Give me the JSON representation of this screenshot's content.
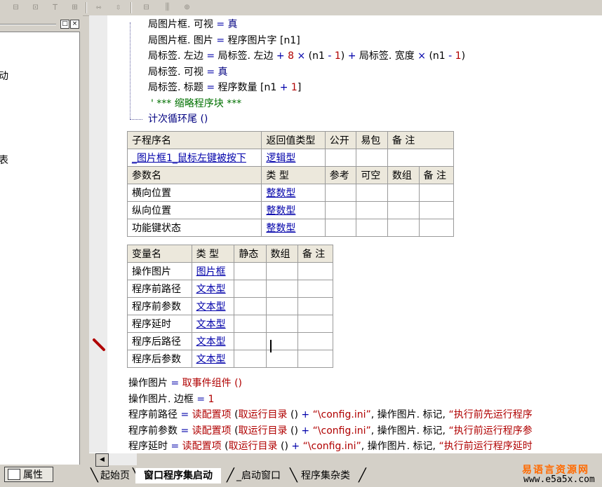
{
  "toolbar": {
    "icons": [
      "align-left-icon",
      "align-center-icon",
      "align-top-icon",
      "align-middle-icon",
      "same-width-icon",
      "same-height-icon",
      "space-horizontal-icon",
      "space-vertical-icon",
      "center-icon"
    ]
  },
  "left_panel": {
    "partial_text_1": "动",
    "partial_text_2": "表",
    "min_btn": "□",
    "close_btn": "×",
    "prop_label": "属性"
  },
  "code_top": [
    {
      "parts": [
        {
          "t": "局图片框. 可视 "
        },
        {
          "t": "= ",
          "c": "kw-blue"
        },
        {
          "t": "真",
          "c": "kw-navy"
        }
      ]
    },
    {
      "parts": [
        {
          "t": "局图片框. 图片 "
        },
        {
          "t": "= ",
          "c": "kw-blue"
        },
        {
          "t": "程序图片字 [n1]"
        }
      ]
    },
    {
      "parts": [
        {
          "t": "局标签. 左边 "
        },
        {
          "t": "= ",
          "c": "kw-blue"
        },
        {
          "t": "局标签. 左边 "
        },
        {
          "t": "+ ",
          "c": "kw-blue"
        },
        {
          "t": "8 ",
          "c": "kw-red"
        },
        {
          "t": "× ",
          "c": "kw-blue"
        },
        {
          "t": "(n1 "
        },
        {
          "t": "- ",
          "c": "kw-blue"
        },
        {
          "t": "1",
          "c": "kw-red"
        },
        {
          "t": ") "
        },
        {
          "t": "+ ",
          "c": "kw-blue"
        },
        {
          "t": "局标签. 宽度 "
        },
        {
          "t": "× ",
          "c": "kw-blue"
        },
        {
          "t": "(n1 "
        },
        {
          "t": "- ",
          "c": "kw-blue"
        },
        {
          "t": "1",
          "c": "kw-red"
        },
        {
          "t": ")"
        }
      ]
    },
    {
      "parts": [
        {
          "t": "局标签. 可视 "
        },
        {
          "t": "= ",
          "c": "kw-blue"
        },
        {
          "t": "真",
          "c": "kw-navy"
        }
      ]
    },
    {
      "parts": [
        {
          "t": "局标签. 标题 "
        },
        {
          "t": "= ",
          "c": "kw-blue"
        },
        {
          "t": "程序数量 [n1 "
        },
        {
          "t": "+ ",
          "c": "kw-blue"
        },
        {
          "t": "1",
          "c": "kw-red"
        },
        {
          "t": "]"
        }
      ]
    },
    {
      "parts": [
        {
          "t": "' *** 缩略程序块 ***",
          "c": "kw-green"
        }
      ]
    },
    {
      "parts": [
        {
          "t": "计次循环尾 ()",
          "c": "kw-navy"
        }
      ]
    }
  ],
  "sub_table": {
    "header": [
      "子程序名",
      "返回值类型",
      "公开",
      "易包",
      "备 注"
    ],
    "row": [
      "_图片框1_鼠标左键被按下",
      "逻辑型",
      "",
      "",
      ""
    ],
    "param_header": [
      "参数名",
      "类 型",
      "参考",
      "可空",
      "数组",
      "备 注"
    ],
    "params": [
      [
        "横向位置",
        "整数型",
        "",
        "",
        "",
        ""
      ],
      [
        "纵向位置",
        "整数型",
        "",
        "",
        "",
        ""
      ],
      [
        "功能键状态",
        "整数型",
        "",
        "",
        "",
        ""
      ]
    ]
  },
  "var_table": {
    "header": [
      "变量名",
      "类 型",
      "静态",
      "数组",
      "备 注"
    ],
    "rows": [
      [
        "操作图片",
        "图片框",
        "",
        "",
        ""
      ],
      [
        "程序前路径",
        "文本型",
        "",
        "",
        ""
      ],
      [
        "程序前参数",
        "文本型",
        "",
        "",
        ""
      ],
      [
        "程序延时",
        "文本型",
        "",
        "",
        ""
      ],
      [
        "程序后路径",
        "文本型",
        "",
        "",
        ""
      ],
      [
        "程序后参数",
        "文本型",
        "",
        "",
        ""
      ]
    ]
  },
  "code_bottom": [
    {
      "parts": [
        {
          "t": "操作图片 "
        },
        {
          "t": "= ",
          "c": "kw-blue"
        },
        {
          "t": "取事件组件 ()",
          "c": "kw-red"
        }
      ]
    },
    {
      "parts": [
        {
          "t": "操作图片. 边框 "
        },
        {
          "t": "= ",
          "c": "kw-blue"
        },
        {
          "t": "1",
          "c": "kw-red"
        }
      ]
    },
    {
      "parts": [
        {
          "t": "程序前路径 "
        },
        {
          "t": "= ",
          "c": "kw-blue"
        },
        {
          "t": "读配置项",
          "c": "kw-red"
        },
        {
          "t": " (",
          "c": ""
        },
        {
          "t": "取运行目录",
          "c": "kw-red"
        },
        {
          "t": " () "
        },
        {
          "t": "+ ",
          "c": "kw-blue"
        },
        {
          "t": "“\\config.ini”",
          "c": "kw-red"
        },
        {
          "t": ", 操作图片. 标记, "
        },
        {
          "t": "“执行前先运行程序",
          "c": "kw-red"
        }
      ]
    },
    {
      "parts": [
        {
          "t": "程序前参数 "
        },
        {
          "t": "= ",
          "c": "kw-blue"
        },
        {
          "t": "读配置项",
          "c": "kw-red"
        },
        {
          "t": " (",
          "c": ""
        },
        {
          "t": "取运行目录",
          "c": "kw-red"
        },
        {
          "t": " () "
        },
        {
          "t": "+ ",
          "c": "kw-blue"
        },
        {
          "t": "“\\config.ini”",
          "c": "kw-red"
        },
        {
          "t": ", 操作图片. 标记, "
        },
        {
          "t": "“执行前运行程序参",
          "c": "kw-red"
        }
      ]
    },
    {
      "parts": [
        {
          "t": "程序延时 "
        },
        {
          "t": "= ",
          "c": "kw-blue"
        },
        {
          "t": "读配置项",
          "c": "kw-red"
        },
        {
          "t": " (",
          "c": ""
        },
        {
          "t": "取运行目录",
          "c": "kw-red"
        },
        {
          "t": " () "
        },
        {
          "t": "+ ",
          "c": "kw-blue"
        },
        {
          "t": "“\\config.ini”",
          "c": "kw-red"
        },
        {
          "t": ", 操作图片. 标记, "
        },
        {
          "t": "“执行前运行程序延时",
          "c": "kw-red"
        }
      ]
    }
  ],
  "tabs": [
    "起始页",
    "窗口程序集启动",
    "_启动窗口",
    "程序集杂类"
  ],
  "brand": {
    "line1": "易语言资源网",
    "line2": "www.e5a5x.com"
  }
}
